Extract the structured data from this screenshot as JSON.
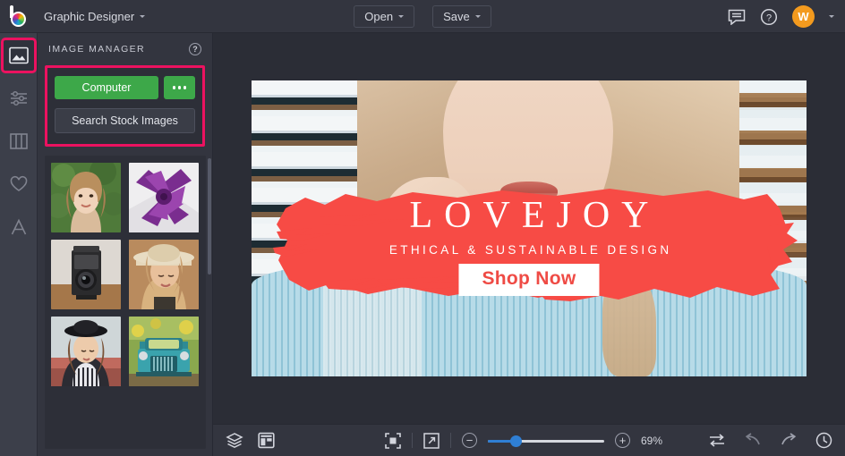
{
  "app": {
    "logo_name": "befunky-logo",
    "document_title": "Graphic Designer"
  },
  "topbar": {
    "open_label": "Open",
    "save_label": "Save",
    "chat_icon": "comment-icon",
    "help_icon": "help-circle-icon",
    "avatar_initial": "W"
  },
  "rail": {
    "items": [
      {
        "name": "image-manager",
        "icon": "image-icon",
        "active": true
      },
      {
        "name": "edit-adjust",
        "icon": "sliders-icon",
        "active": false
      },
      {
        "name": "templates",
        "icon": "columns-icon",
        "active": false
      },
      {
        "name": "graphics",
        "icon": "heart-icon",
        "active": false
      },
      {
        "name": "text",
        "icon": "text-a-icon",
        "active": false
      }
    ]
  },
  "panel": {
    "title": "IMAGE MANAGER",
    "help_icon": "question-mark-icon",
    "computer_label": "Computer",
    "more_label": "more-options-icon",
    "search_stock_label": "Search Stock Images",
    "thumbnails": [
      {
        "name": "thumb-woman-green-foliage",
        "alt": "Smiling woman with long blonde hair and green hedge background"
      },
      {
        "name": "thumb-purple-gift-bow",
        "alt": "Purple paper flower gift bow on white box"
      },
      {
        "name": "thumb-vintage-camera",
        "alt": "Vintage twin-lens reflex camera on wooden table"
      },
      {
        "name": "thumb-woman-straw-hat",
        "alt": "Woman in straw hat with wavy blonde hair laughing"
      },
      {
        "name": "thumb-woman-black-hat",
        "alt": "Woman in black wide-brim hat and striped sleeves"
      },
      {
        "name": "thumb-teal-vintage-truck",
        "alt": "Teal vintage pickup truck with yellow flowers"
      }
    ]
  },
  "canvas": {
    "banner": {
      "brand": "LOVEJOY",
      "tagline": "ETHICAL & SUSTAINABLE DESIGN",
      "cta_label": "Shop Now",
      "photo_alt": "Close-up of blonde woman in light blue ribbed turtleneck against white window blinds",
      "brush_color": "#f74b45",
      "cta_text_color": "#ef4b45",
      "cta_bg_color": "#ffffff"
    }
  },
  "bottombar": {
    "layers_icon": "layers-icon",
    "layout_icon": "layout-panel-icon",
    "fit_icon": "fit-to-screen-icon",
    "expand_icon": "expand-arrow-icon",
    "zoom_out_label": "−",
    "zoom_in_label": "+",
    "zoom_value": "69%",
    "zoom_slider_percent": 24,
    "resize_icon": "swap-arrows-icon",
    "undo_icon": "undo-arrow-icon",
    "redo_icon": "redo-arrow-icon",
    "history_icon": "history-clock-icon"
  },
  "colors": {
    "accent_pink": "#ec1260",
    "green": "#3da849",
    "avatar_orange": "#f39a1e",
    "slider_blue": "#2f7fd4",
    "chrome_dark": "#33353f",
    "canvas_dark": "#2b2d36"
  }
}
